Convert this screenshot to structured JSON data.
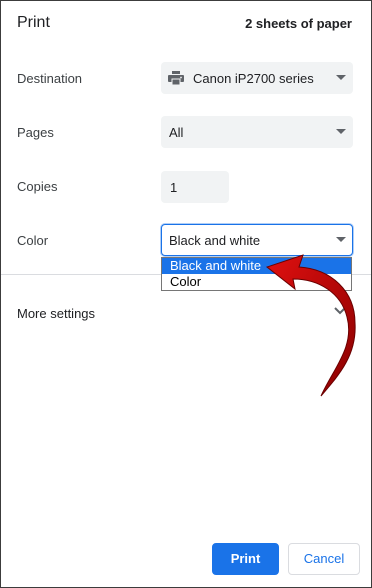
{
  "dialog": {
    "title": "Print",
    "sheets": "2 sheets of paper"
  },
  "destination": {
    "label": "Destination",
    "value": "Canon iP2700 series",
    "icon": "printer-icon"
  },
  "pages": {
    "label": "Pages",
    "value": "All"
  },
  "copies": {
    "label": "Copies",
    "value": "1"
  },
  "color": {
    "label": "Color",
    "value": "Black and white",
    "options": [
      "Black and white",
      "Color"
    ],
    "selected_index": 0
  },
  "more_settings": {
    "label": "More settings"
  },
  "buttons": {
    "print": "Print",
    "cancel": "Cancel"
  },
  "colors": {
    "accent": "#1a73e8",
    "select_bg": "#f1f3f4",
    "annotation_arrow": "#c00000"
  }
}
